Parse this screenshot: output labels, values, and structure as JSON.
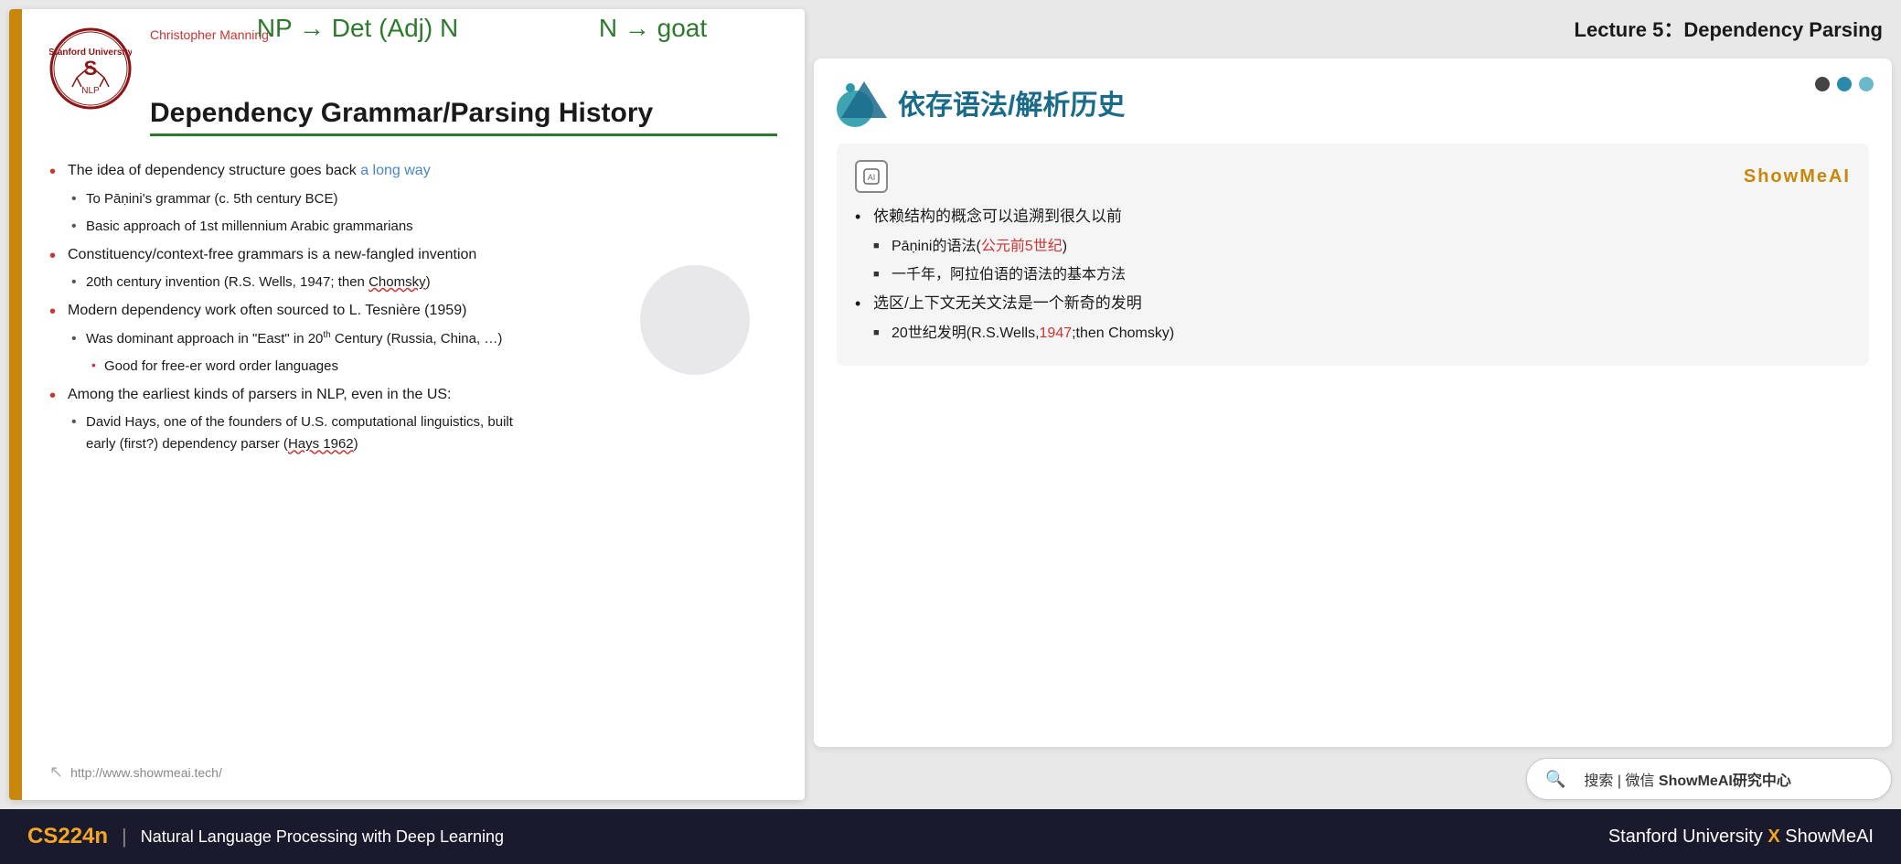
{
  "lecture": {
    "title": "Lecture 5：Dependency Parsing"
  },
  "slide": {
    "author": "Christopher Manning",
    "formula_left": "NP → Det (Adj) N",
    "formula_right": "N → goat",
    "title": "Dependency Grammar/Parsing History",
    "bullets": [
      {
        "level": "main",
        "text": "The idea of dependency structure goes back a long way",
        "highlight": "a long way"
      },
      {
        "level": "sub",
        "text": "To Pāṇini's grammar (c. 5th century BCE)"
      },
      {
        "level": "sub",
        "text": "Basic approach of 1st millennium Arabic grammarians"
      },
      {
        "level": "main",
        "text": "Constituency/context-free grammars is a new-fangled invention"
      },
      {
        "level": "sub",
        "text": "20th century invention (R.S. Wells, 1947; then Chomsky)"
      },
      {
        "level": "main",
        "text": "Modern dependency work often sourced to L. Tesnière (1959)"
      },
      {
        "level": "sub",
        "text": "Was dominant approach in \"East\" in 20th Century (Russia, China, …)"
      },
      {
        "level": "subsub",
        "text": "Good for free-er word order languages"
      },
      {
        "level": "main",
        "text": "Among the earliest kinds of parsers in NLP, even in the US:"
      },
      {
        "level": "sub",
        "text": "David Hays, one of the founders of U.S. computational linguistics, built early (first?) dependency parser (Hays 1962)"
      }
    ],
    "footer_url": "http://www.showmeai.tech/"
  },
  "chinese_slide": {
    "title": "依存语法/解析历史",
    "brand": "ShowMeAI",
    "bullets": [
      {
        "level": "main",
        "text": "依赖结构的概念可以追溯到很久以前"
      },
      {
        "level": "sub",
        "text_parts": [
          "Pāṇini的语法(",
          "公元前5世纪",
          ")"
        ],
        "highlight_index": 1
      },
      {
        "level": "sub",
        "text": "一千年，阿拉伯语的语法的基本方法"
      },
      {
        "level": "main",
        "text": "选区/上下文无关文法是一个新奇的发明"
      },
      {
        "level": "sub",
        "text_parts": [
          "20世纪发明(R.S.Wells,",
          "1947",
          ";then Chomsky)"
        ],
        "highlight_index": 1
      }
    ]
  },
  "search_bar": {
    "placeholder": "搜索 | 微信 ShowMeAI研究中心"
  },
  "bottom_bar": {
    "course_code": "CS224n",
    "separator": "|",
    "course_name": "Natural Language Processing with Deep Learning",
    "right_text": "Stanford University",
    "x_label": "X",
    "brand": "ShowMeAI"
  },
  "dots": [
    {
      "color": "dark"
    },
    {
      "color": "teal"
    },
    {
      "color": "light-teal"
    }
  ]
}
